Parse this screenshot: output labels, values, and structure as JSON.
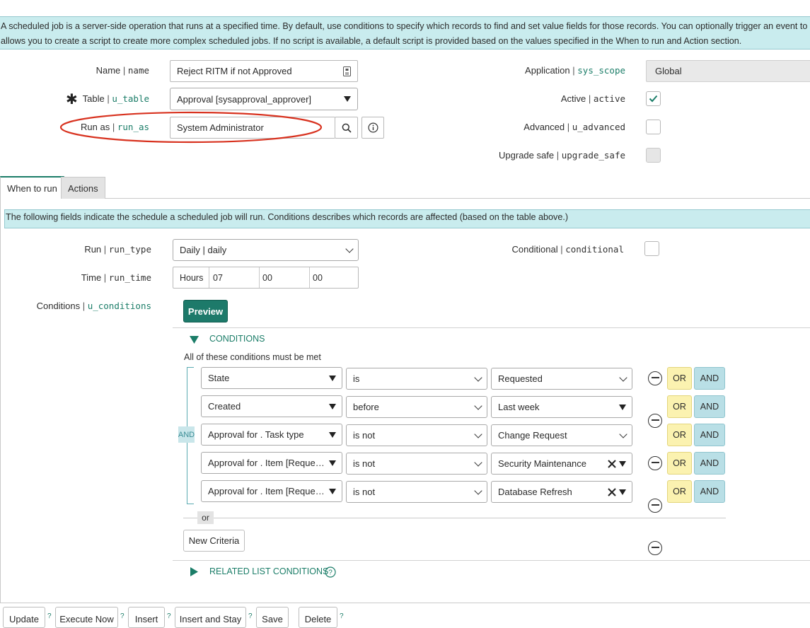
{
  "info_banner": {
    "line1": "A scheduled job is a server-side operation that runs at a specified time. By default, use conditions to specify which records to find and set value fields for those records. You can optionally trigger an event to send a n",
    "line2": "allows you to create a script to create more complex scheduled jobs. If no script is available, a default script is provided based on the values specified in the When to run and Action section."
  },
  "fields": {
    "name": {
      "label": "Name",
      "sep": " | ",
      "field": "name",
      "value": "Reject RITM if not Approved"
    },
    "table": {
      "required_mark": "✱",
      "label": "Table",
      "sep": " | ",
      "field": "u_table",
      "value": "Approval [sysapproval_approver]"
    },
    "run_as": {
      "label": "Run as",
      "sep": " | ",
      "field": "run_as",
      "value": "System Administrator"
    },
    "application": {
      "label": "Application",
      "sep": " | ",
      "field": "sys_scope",
      "value": "Global"
    },
    "active": {
      "label": "Active",
      "sep": " | ",
      "field": "active",
      "checked": true
    },
    "advanced": {
      "label": "Advanced",
      "sep": " | ",
      "field": "u_advanced",
      "checked": false
    },
    "upgrade_safe": {
      "label": "Upgrade safe",
      "sep": " | ",
      "field": "upgrade_safe",
      "checked": false
    }
  },
  "tabs": [
    {
      "label": "When to run",
      "active": true
    },
    {
      "label": "Actions",
      "active": false
    }
  ],
  "tab_banner": "The following fields indicate the schedule a scheduled job will run. Conditions describes which records are affected (based on the table above.)",
  "when": {
    "run": {
      "label": "Run",
      "sep": " | ",
      "field": "run_type",
      "value": "Daily | daily"
    },
    "conditional": {
      "label": "Conditional",
      "sep": " | ",
      "field": "conditional",
      "checked": false
    },
    "time": {
      "label": "Time",
      "sep": " | ",
      "field": "run_time",
      "unit": "Hours",
      "hours": "07",
      "minutes": "00",
      "seconds": "00"
    },
    "conditions": {
      "label": "Conditions",
      "sep": " | ",
      "field": "u_conditions"
    }
  },
  "condition_builder": {
    "preview_label": "Preview",
    "header": "CONDITIONS",
    "must_be_met": "All of these conditions must be met",
    "and_label": "AND",
    "or_label": "OR",
    "or_divider": "or",
    "new_criteria": "New Criteria",
    "related_list": "RELATED LIST CONDITIONS",
    "rows": [
      {
        "field": "State",
        "operator": "is",
        "value": "Requested",
        "value_style": "select"
      },
      {
        "field": "Created",
        "operator": "before",
        "value": "Last week",
        "value_style": "caret"
      },
      {
        "field": "Approval for . Task type",
        "operator": "is not",
        "value": "Change Request",
        "value_style": "select"
      },
      {
        "field": "Approval for . Item [Reque…",
        "operator": "is not",
        "value": "Security Maintenance",
        "value_style": "clear"
      },
      {
        "field": "Approval for . Item [Reque…",
        "operator": "is not",
        "value": "Database Refresh",
        "value_style": "clear"
      }
    ]
  },
  "actions": {
    "update": "Update",
    "execute_now": "Execute Now",
    "insert": "Insert",
    "insert_and_stay": "Insert and Stay",
    "save": "Save",
    "delete": "Delete",
    "help": "?"
  },
  "colors": {
    "banner_bg": "#c9ecee",
    "field_name": "#1b7d68",
    "preview_bg": "#1d7a6a",
    "highlight_ring": "#d8321f",
    "or_bg": "#fbf2b0",
    "and_bg": "#b9dfe6"
  }
}
